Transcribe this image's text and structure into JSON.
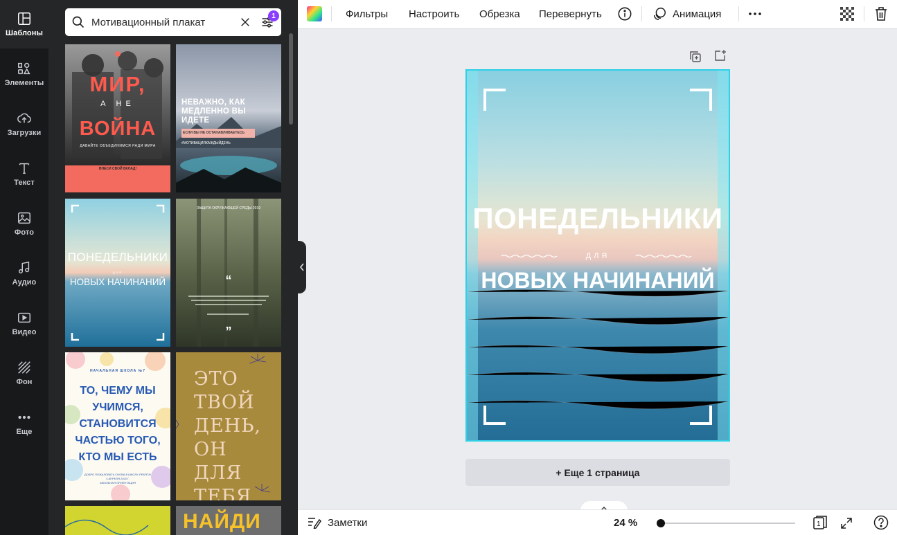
{
  "rail": {
    "items": [
      {
        "label": "Шаблоны",
        "icon": "templates-icon"
      },
      {
        "label": "Элементы",
        "icon": "elements-icon"
      },
      {
        "label": "Загрузки",
        "icon": "upload-cloud-icon"
      },
      {
        "label": "Текст",
        "icon": "text-icon"
      },
      {
        "label": "Фото",
        "icon": "photo-icon"
      },
      {
        "label": "Аудио",
        "icon": "music-note-icon"
      },
      {
        "label": "Видео",
        "icon": "video-icon"
      },
      {
        "label": "Фон",
        "icon": "background-icon"
      },
      {
        "label": "Еще",
        "icon": "more-dots-icon"
      }
    ]
  },
  "search": {
    "value": "Мотивационный плакат",
    "filter_count": "1"
  },
  "templates": [
    {
      "name": "war-poster",
      "lines": [
        "МИР,",
        "А НЕ",
        "ВОЙНА",
        "ДАВАЙТЕ ОБЪЕДИНИМСЯ РАДИ МИРА",
        "ВНЕСИ СВОЙ ВКЛАД!"
      ]
    },
    {
      "name": "mountain-lake-poster",
      "lines": [
        "НЕВАЖНО, КАК",
        "МЕДЛЕННО ВЫ",
        "ИДЕТЕ",
        "ЕСЛИ ВЫ НЕ ОСТАНАВЛИВАЕТЕСЬ",
        "#МОТИВАЦИЯКАЖДЫЙДЕНЬ"
      ]
    },
    {
      "name": "monday-sea-poster",
      "lines": [
        "ПОНЕДЕЛЬНИКИ",
        "ДЛЯ",
        "НОВЫХ НАЧИНАНИЙ"
      ]
    },
    {
      "name": "forest-quote-poster",
      "lines": [
        "ЗАЩИТА ОКРУЖАЮЩЕЙ СРЕДЫ 2019",
        "“",
        "”"
      ]
    },
    {
      "name": "school-hands-poster",
      "lines": [
        "НАЧАЛЬНАЯ ШКОЛА №7",
        "ТО, ЧЕМУ МЫ",
        "УЧИМСЯ,",
        "СТАНОВИТСЯ",
        "ЧАСТЬЮ ТОГО,",
        "КТО МЫ ЕСТЬ",
        "ДОБРО ПОЖАЛОВАТЬ СНОВА В ШКОЛУ, РЕБЯТА!",
        "4 АПРЕЛЯ 2020 Г.",
        "ШКОЛЬНАЯ ОРИЕНТАЦИЯ"
      ]
    },
    {
      "name": "your-day-poster",
      "lines": [
        "ЭТО",
        "ТВОЙ",
        "ДЕНЬ,",
        "ОН ДЛЯ",
        "ТЕБЯ"
      ]
    },
    {
      "name": "yellow-partial-poster",
      "lines": []
    },
    {
      "name": "find-poster",
      "lines": [
        "НАЙДИ"
      ]
    }
  ],
  "toolbar": {
    "filters": "Фильтры",
    "adjust": "Настроить",
    "crop": "Обрезка",
    "flip": "Перевернуть",
    "animation": "Анимация"
  },
  "canvas": {
    "title_line1": "ПОНЕДЕЛЬНИКИ",
    "small_word": "ДЛЯ",
    "title_line2": "НОВЫХ НАЧИНАНИЙ",
    "add_page": "+ Еще 1 страница"
  },
  "bottom": {
    "notes": "Заметки",
    "zoom": "24 %",
    "page_count": "1"
  },
  "colors": {
    "accent": "#8b3dff",
    "selection": "#2fd1e6",
    "rail_bg": "#18191b",
    "panel_bg": "#252627"
  }
}
